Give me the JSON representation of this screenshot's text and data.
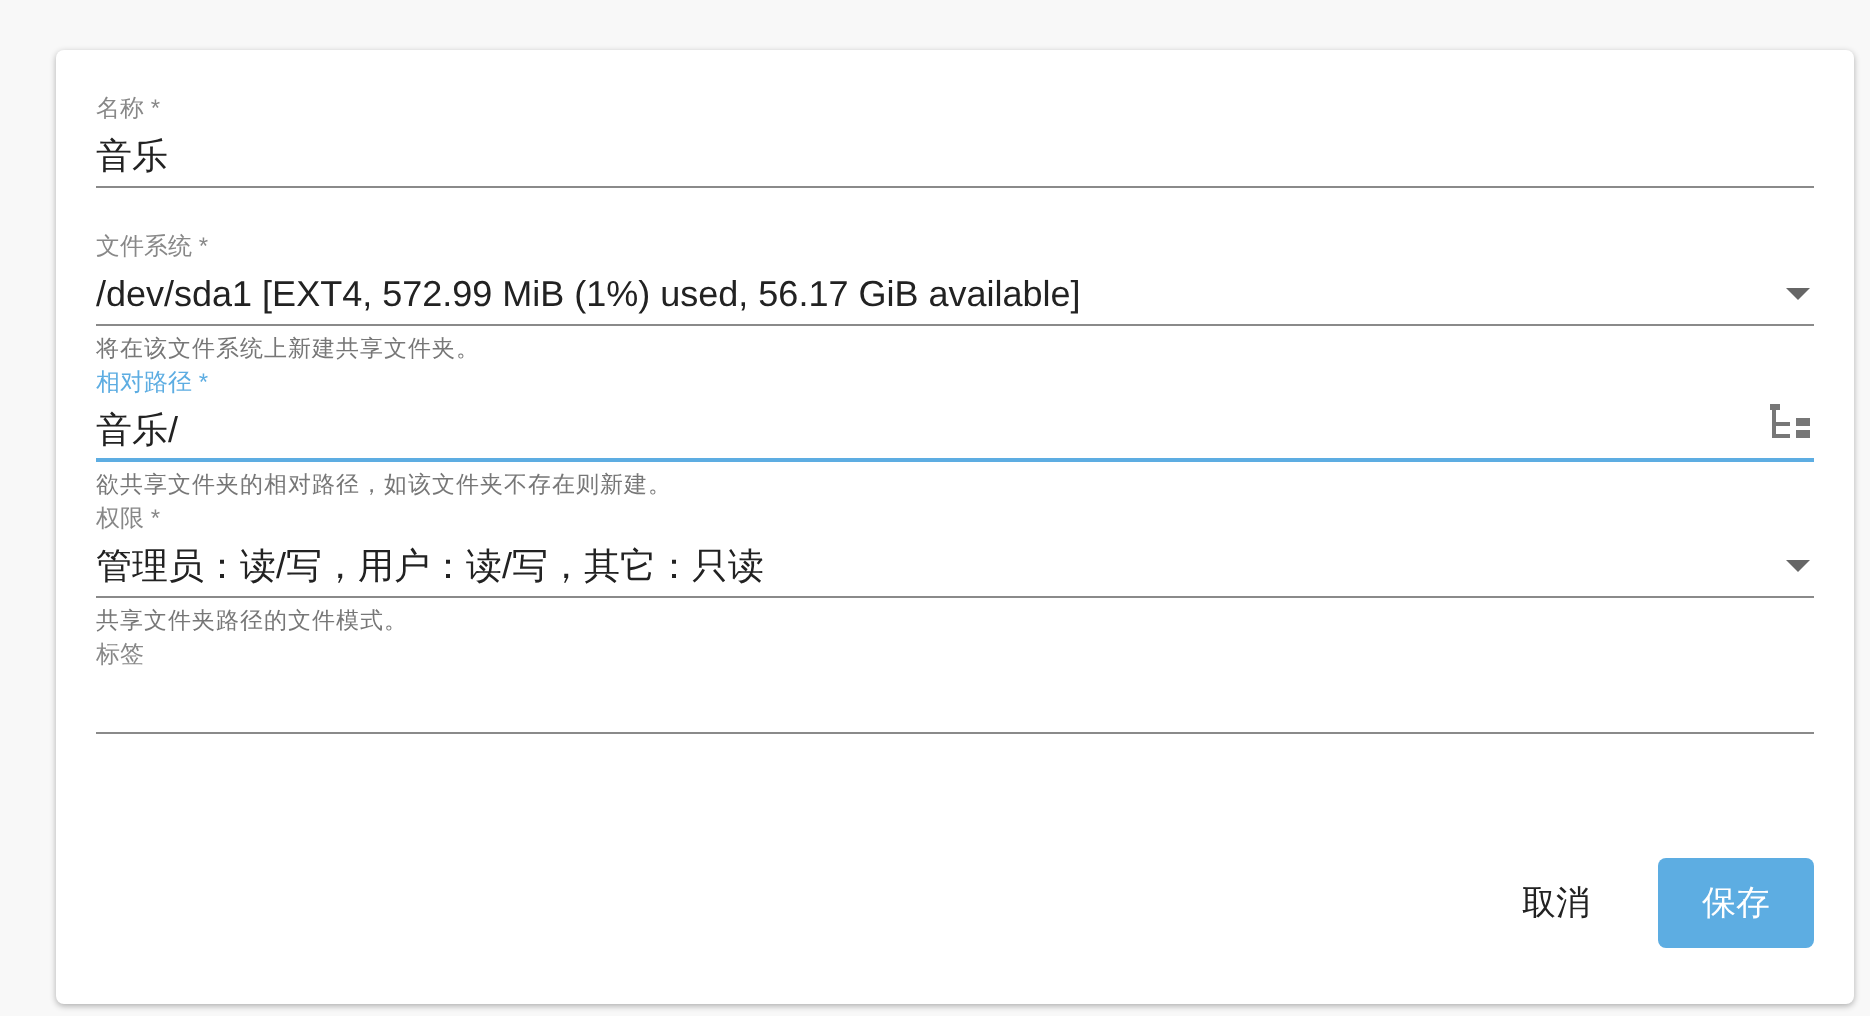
{
  "fields": [
    {
      "kind": "text",
      "label": "名称 *",
      "value": "音乐",
      "focused": false
    },
    {
      "kind": "select",
      "label": "文件系统 *",
      "value": "/dev/sda1 [EXT4, 572.99 MiB (1%) used, 56.17 GiB available]",
      "focused": false,
      "hint": "将在该文件系统上新建共享文件夹。"
    },
    {
      "kind": "folder",
      "label": "相对路径 *",
      "value": "音乐/",
      "focused": true,
      "hint": "欲共享文件夹的相对路径，如该文件夹不存在则新建。"
    },
    {
      "kind": "select",
      "label": "权限 *",
      "value": "管理员：读/写，用户：读/写，其它：只读",
      "focused": false,
      "hint": "共享文件夹路径的文件模式。"
    },
    {
      "kind": "text",
      "label": "标签",
      "focused": false
    }
  ],
  "buttons": [
    {
      "label": "取消",
      "kind": "flat"
    },
    {
      "label": "保存",
      "kind": "primary"
    }
  ]
}
